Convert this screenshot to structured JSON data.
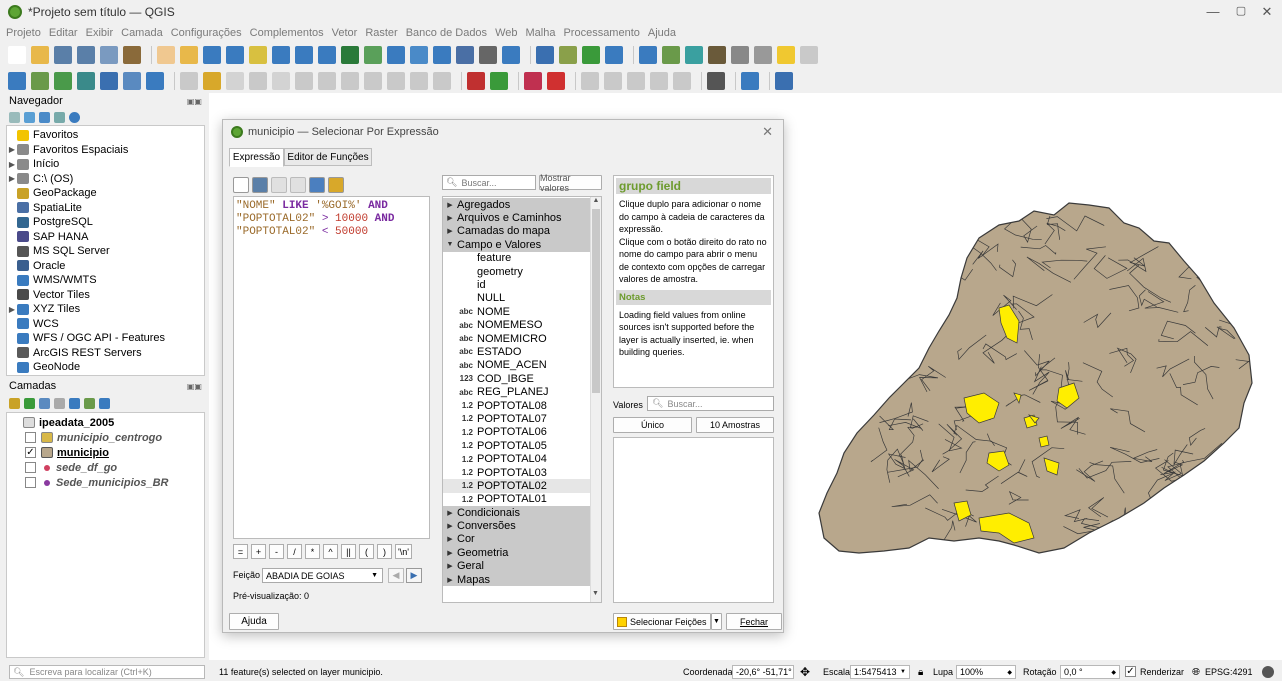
{
  "window": {
    "title": "*Projeto sem título — QGIS",
    "min": "—",
    "max": "▢",
    "close": "✕"
  },
  "menu": [
    "Projeto",
    "Editar",
    "Exibir",
    "Camada",
    "Configurações",
    "Complementos",
    "Vetor",
    "Raster",
    "Banco de Dados",
    "Web",
    "Malha",
    "Processamento",
    "Ajuda"
  ],
  "browser": {
    "title": "Navegador",
    "items": [
      {
        "label": "Favoritos",
        "arrow": "",
        "color": "#f2c400"
      },
      {
        "label": "Favoritos Espaciais",
        "arrow": "▶",
        "color": "#8a8a8a"
      },
      {
        "label": "Início",
        "arrow": "▶",
        "color": "#8a8a8a"
      },
      {
        "label": "C:\\ (OS)",
        "arrow": "▶",
        "color": "#8a8a8a"
      },
      {
        "label": "GeoPackage",
        "arrow": "",
        "color": "#c9a227"
      },
      {
        "label": "SpatiaLite",
        "arrow": "",
        "color": "#4a6fa5"
      },
      {
        "label": "PostgreSQL",
        "arrow": "",
        "color": "#336791"
      },
      {
        "label": "SAP HANA",
        "arrow": "",
        "color": "#4a4a8a"
      },
      {
        "label": "MS SQL Server",
        "arrow": "",
        "color": "#555"
      },
      {
        "label": "Oracle",
        "arrow": "",
        "color": "#3a5f8f"
      },
      {
        "label": "WMS/WMTS",
        "arrow": "",
        "color": "#3a7bbf"
      },
      {
        "label": "Vector Tiles",
        "arrow": "",
        "color": "#4a4a4a"
      },
      {
        "label": "XYZ Tiles",
        "arrow": "▶",
        "color": "#3a7bbf"
      },
      {
        "label": "WCS",
        "arrow": "",
        "color": "#3a7bbf"
      },
      {
        "label": "WFS / OGC API - Features",
        "arrow": "",
        "color": "#3a7bbf"
      },
      {
        "label": "ArcGIS REST Servers",
        "arrow": "",
        "color": "#5a5a5a"
      },
      {
        "label": "GeoNode",
        "arrow": "",
        "color": "#3a7bbf"
      }
    ]
  },
  "layers": {
    "title": "Camadas",
    "items": [
      {
        "label": "ipeadata_2005",
        "style": "group",
        "checked": ""
      },
      {
        "label": "municipio_centrogo",
        "style": "italic",
        "checked": ""
      },
      {
        "label": "municipio",
        "style": "boldul",
        "checked": "✓"
      },
      {
        "label": "sede_df_go",
        "style": "italic",
        "checked": ""
      },
      {
        "label": "Sede_municipios_BR",
        "style": "italic",
        "checked": ""
      }
    ]
  },
  "dialog": {
    "title": "municipio — Selecionar Por Expressão",
    "tab_expression": "Expressão",
    "tab_functions": "Editor de Funções",
    "expr_line1_a": "\"NOME\"",
    "expr_line1_b": "LIKE",
    "expr_line1_c": "'%GOI%'",
    "expr_line1_d": "AND",
    "expr_line2_a": "\"POPTOTAL02\"",
    "expr_line2_b": ">",
    "expr_line2_c": "10000",
    "expr_line2_d": "AND",
    "expr_line3_a": "\"POPTOTAL02\"",
    "expr_line3_b": "<",
    "expr_line3_c": "50000",
    "operators": [
      "=",
      "+",
      "-",
      "/",
      "*",
      "^",
      "||",
      "(",
      ")",
      "'\\n'"
    ],
    "feature_label": "Feição",
    "feature_value": "ABADIA DE GOIAS",
    "preview": "Pré-visualização: 0",
    "help_button": "Ajuda",
    "search_placeholder": "Buscar...",
    "show_values": "Mostrar valores",
    "functions": [
      {
        "label": "Agregados",
        "type": "group",
        "arrow": "▶"
      },
      {
        "label": "Arquivos e Caminhos",
        "type": "group",
        "arrow": "▶"
      },
      {
        "label": "Camadas do mapa",
        "type": "group",
        "arrow": "▶"
      },
      {
        "label": "Campo e Valores",
        "type": "group",
        "arrow": "▼"
      },
      {
        "label": "feature",
        "type": "plain",
        "ft": ""
      },
      {
        "label": "geometry",
        "type": "plain",
        "ft": ""
      },
      {
        "label": "id",
        "type": "plain",
        "ft": ""
      },
      {
        "label": "NULL",
        "type": "plain",
        "ft": ""
      },
      {
        "label": "NOME",
        "type": "field",
        "ft": "abc"
      },
      {
        "label": "NOMEMESO",
        "type": "field",
        "ft": "abc"
      },
      {
        "label": "NOMEMICRO",
        "type": "field",
        "ft": "abc"
      },
      {
        "label": "ESTADO",
        "type": "field",
        "ft": "abc"
      },
      {
        "label": "NOME_ACEN",
        "type": "field",
        "ft": "abc"
      },
      {
        "label": "COD_IBGE",
        "type": "field",
        "ft": "123"
      },
      {
        "label": "REG_PLANEJ",
        "type": "field",
        "ft": "abc"
      },
      {
        "label": "POPTOTAL08",
        "type": "field",
        "ft": "1.2"
      },
      {
        "label": "POPTOTAL07",
        "type": "field",
        "ft": "1.2"
      },
      {
        "label": "POPTOTAL06",
        "type": "field",
        "ft": "1.2"
      },
      {
        "label": "POPTOTAL05",
        "type": "field",
        "ft": "1.2"
      },
      {
        "label": "POPTOTAL04",
        "type": "field",
        "ft": "1.2"
      },
      {
        "label": "POPTOTAL03",
        "type": "field",
        "ft": "1.2"
      },
      {
        "label": "POPTOTAL02",
        "type": "selected",
        "ft": "1.2"
      },
      {
        "label": "POPTOTAL01",
        "type": "field",
        "ft": "1.2"
      },
      {
        "label": "Condicionais",
        "type": "group",
        "arrow": "▶"
      },
      {
        "label": "Conversões",
        "type": "group",
        "arrow": "▶"
      },
      {
        "label": "Cor",
        "type": "group",
        "arrow": "▶"
      },
      {
        "label": "Geometria",
        "type": "group",
        "arrow": "▶"
      },
      {
        "label": "Geral",
        "type": "group",
        "arrow": "▶"
      },
      {
        "label": "Mapas",
        "type": "group",
        "arrow": "▶"
      }
    ],
    "help_title": "grupo field",
    "help_text": "Clique duplo para adicionar o nome do campo à cadeia de caracteres da expressão.\nClique com o botão direito do rato no nome do campo para abrir o menu de contexto com opções de carregar valores de amostra.",
    "notes_title": "Notas",
    "notes_text": "Loading field values from online sources isn't supported before the layer is actually inserted, ie. when building queries.",
    "values_label": "Valores",
    "unique_button": "Único",
    "samples_button": "10 Amostras",
    "select_button": "Selecionar Feições",
    "close_button": "Fechar"
  },
  "status": {
    "locate_placeholder": "Escreva para localizar (Ctrl+K)",
    "message": "11 feature(s) selected on layer municipio.",
    "coord_label": "Coordenada",
    "coord_value": "-20,6° -51,71°",
    "scale_label": "Escala",
    "scale_value": "1:5475413",
    "zoom_label": "Lupa",
    "zoom_value": "100%",
    "rotation_label": "Rotação",
    "rotation_value": "0,0 °",
    "render_label": "Renderizar",
    "crs": "EPSG:4291"
  },
  "colors": {
    "map_fill": "#b8a78c",
    "selected": "#ffee00",
    "accent": "#6d9b2e"
  }
}
